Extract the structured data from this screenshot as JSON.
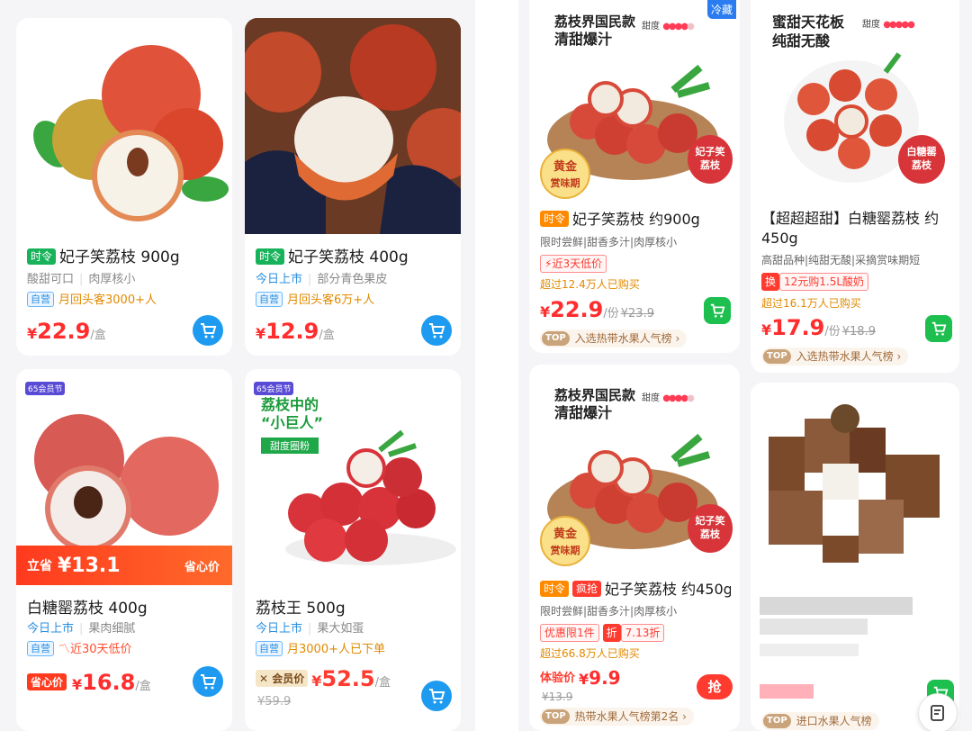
{
  "left": {
    "products": [
      {
        "badge": "时令",
        "title": "妃子笑荔枝 900g",
        "sub1": "酸甜可口",
        "sub2": "肉厚核小",
        "self": "自营",
        "promo": "月回头客3000+人",
        "currency": "¥",
        "price": "22.9",
        "unit": "/盒"
      },
      {
        "badge": "时令",
        "title": "妃子笑荔枝 400g",
        "sub1": "今日上市",
        "sub2": "部分青色果皮",
        "self": "自营",
        "promo": "月回头客6万+人",
        "currency": "¥",
        "price": "12.9",
        "unit": "/盒"
      },
      {
        "corner": "65会员节",
        "banner_left": "立省",
        "banner_amount": "¥13.1",
        "banner_right": "省心价",
        "title": "白糖罂荔枝 400g",
        "sub1": "今日上市",
        "sub2": "果肉细腻",
        "self": "自营",
        "promo": "近30天低价",
        "price_tag": "省心价",
        "currency": "¥",
        "price": "16.8",
        "unit": "/盒"
      },
      {
        "corner": "65会员节",
        "headline_1": "荔枝中的",
        "headline_2": "“小巨人”",
        "headline_tag": "甜度圈粉",
        "title": "荔枝王 500g",
        "sub1": "今日上市",
        "sub2": "果大如蛋",
        "self": "自营",
        "promo": "月3000+人已下单",
        "member_label": "会员价",
        "currency": "¥",
        "price": "52.5",
        "unit": "/盒",
        "original_price": "¥59.9"
      }
    ]
  },
  "right": {
    "products": [
      {
        "poster_title_1": "荔枝界国民款",
        "poster_title_2": "清甜爆汁",
        "sweet_label": "甜度",
        "cold_tag": "冷藏",
        "gold_stamp_1": "黄金",
        "gold_stamp_2": "赏味期",
        "stamp_1": "妃子笑",
        "stamp_2": "荔枝",
        "badge": "时令",
        "title": "妃子笑荔枝 约900g",
        "desc": "限时尝鲜|甜香多汁|肉厚核小",
        "promo": "近3天低价",
        "sales": "超过12.4万人已购买",
        "currency": "¥",
        "price": "22.9",
        "unit": "/份",
        "original_price": "¥23.9",
        "rank_badge": "TOP",
        "rank": "入选热带水果人气榜 ›"
      },
      {
        "poster_title_1": "蜜甜天花板",
        "poster_title_2": "纯甜无酸",
        "sweet_label": "甜度",
        "stamp_1": "白糖罂",
        "stamp_2": "荔枝",
        "title_line1": "【超超超甜】白糖罂荔枝 约",
        "title_line2": "450g",
        "desc": "高甜品种|纯甜无酸|采摘赏味期短",
        "swap_tag": "换",
        "swap_text": "12元购1.5L酸奶",
        "sales": "超过16.1万人已购买",
        "currency": "¥",
        "price": "17.9",
        "unit": "/份",
        "original_price": "¥18.9",
        "rank_badge": "TOP",
        "rank": "入选热带水果人气榜 ›"
      },
      {
        "poster_title_1": "荔枝界国民款",
        "poster_title_2": "清甜爆汁",
        "sweet_label": "甜度",
        "gold_stamp_1": "黄金",
        "gold_stamp_2": "赏味期",
        "stamp_1": "妃子笑",
        "stamp_2": "荔枝",
        "badge": "时令",
        "badge2": "疯抢",
        "title": "妃子笑荔枝 约450g",
        "desc": "限时尝鲜|甜香多汁|肉厚核小",
        "limit_tag": "优惠限1件",
        "disc_tag": "折",
        "disc_text": "7.13折",
        "sales": "超过66.8万人已购买",
        "exp_label": "体验价",
        "currency": "¥",
        "price": "9.9",
        "original_price": "¥13.9",
        "grab": "抢",
        "rank_badge": "TOP",
        "rank": "热带水果人气榜第2名 ›"
      },
      {
        "rank_badge": "TOP",
        "rank": "进口水果人气榜"
      }
    ]
  }
}
